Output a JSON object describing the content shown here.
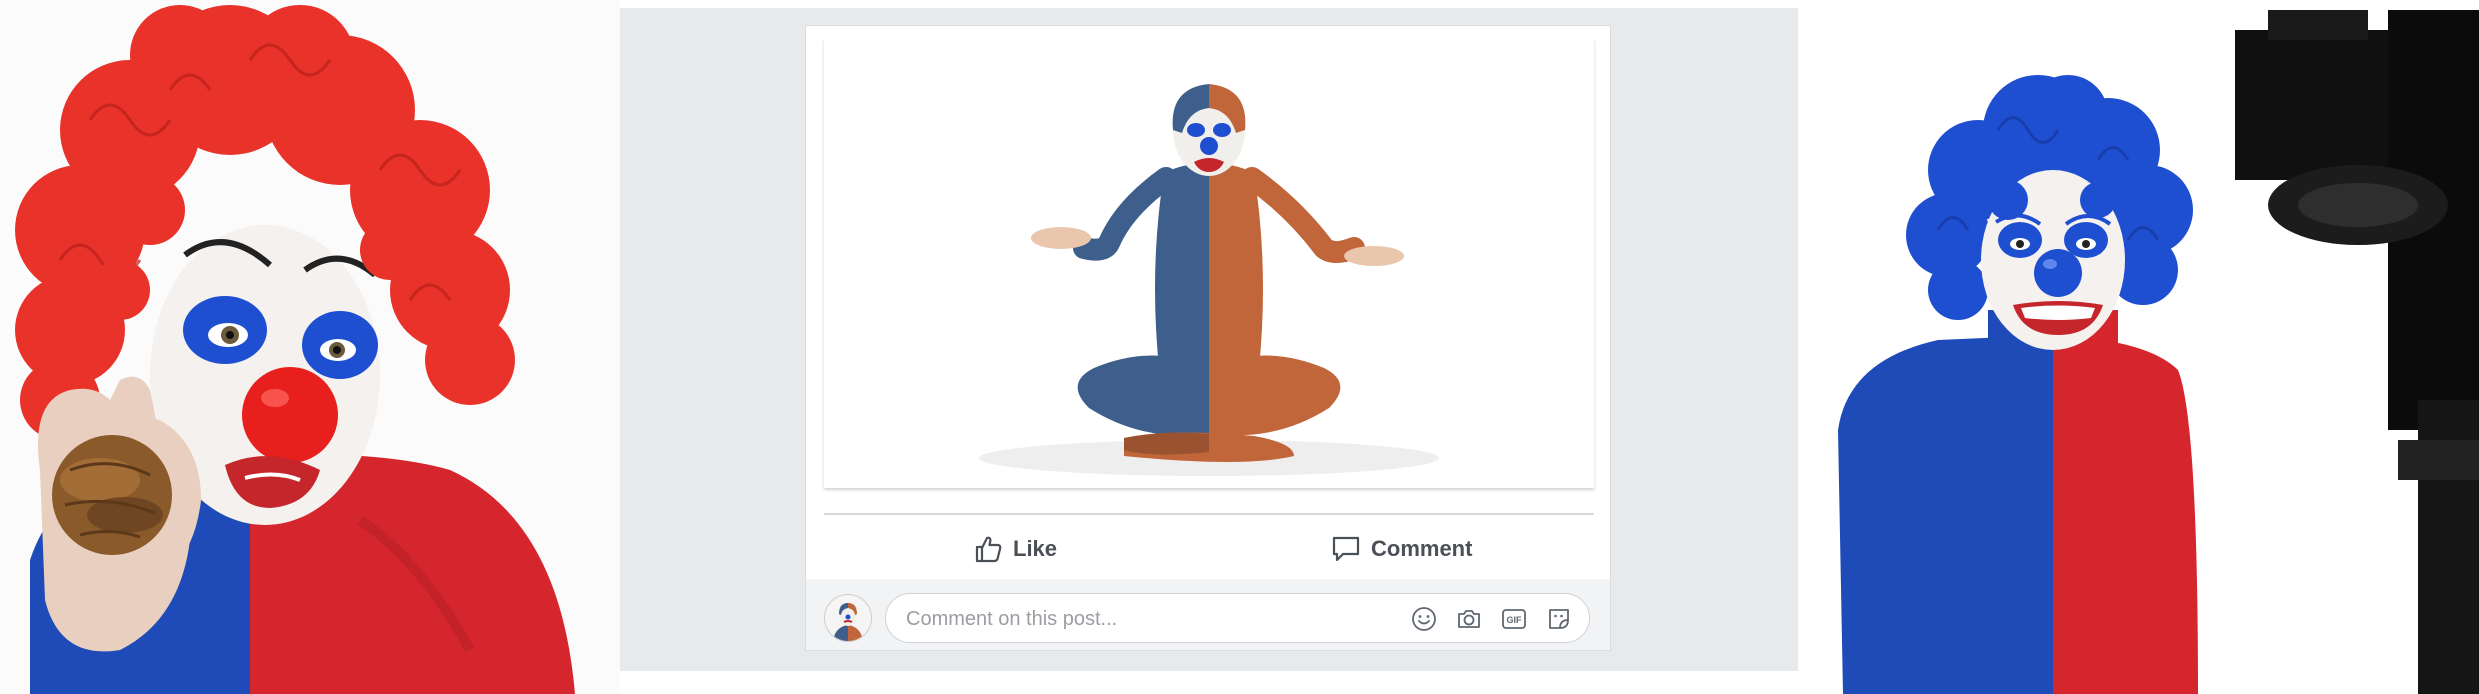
{
  "post": {
    "like_label": "Like",
    "comment_label": "Comment",
    "comment_placeholder": "Comment on this post...",
    "comment_icons": [
      "smiley-icon",
      "camera-icon",
      "gif-icon",
      "sticker-icon"
    ],
    "gif_text": "GIF"
  },
  "colors": {
    "page_bg": "#ffffff",
    "mockup_bg": "#e8e9eb",
    "wig_red": "#e8322a",
    "wig_blue": "#1f4fd1",
    "suit_blue": "#1e4bb8",
    "suit_red": "#d6262d",
    "suit_slate": "#3e5f8c",
    "suit_orange": "#c0663a",
    "action_text": "#4b4f56"
  }
}
